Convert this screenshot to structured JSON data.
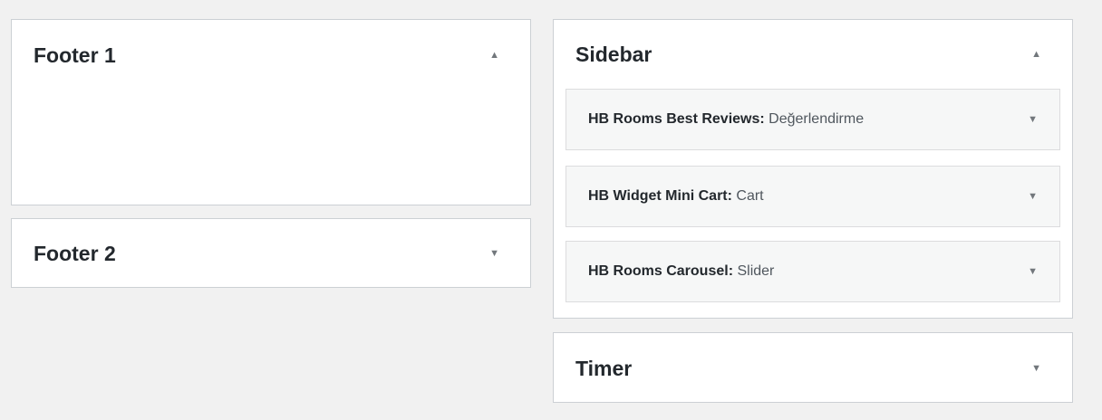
{
  "left": {
    "footer1": {
      "title": "Footer 1",
      "toggle": "▲"
    },
    "footer2": {
      "title": "Footer 2",
      "toggle": "▼"
    }
  },
  "right": {
    "sidebar": {
      "title": "Sidebar",
      "toggle": "▲",
      "widgets": [
        {
          "name": "HB Rooms Best Reviews",
          "sep": ":",
          "subtitle": " Değerlendirme",
          "toggle": "▼"
        },
        {
          "name": "HB Widget Mini Cart",
          "sep": ":",
          "subtitle": " Cart",
          "toggle": "▼"
        },
        {
          "name": "HB Rooms Carousel",
          "sep": ":",
          "subtitle": " Slider",
          "toggle": "▼"
        }
      ]
    },
    "timer": {
      "title": "Timer",
      "toggle": "▼"
    }
  }
}
